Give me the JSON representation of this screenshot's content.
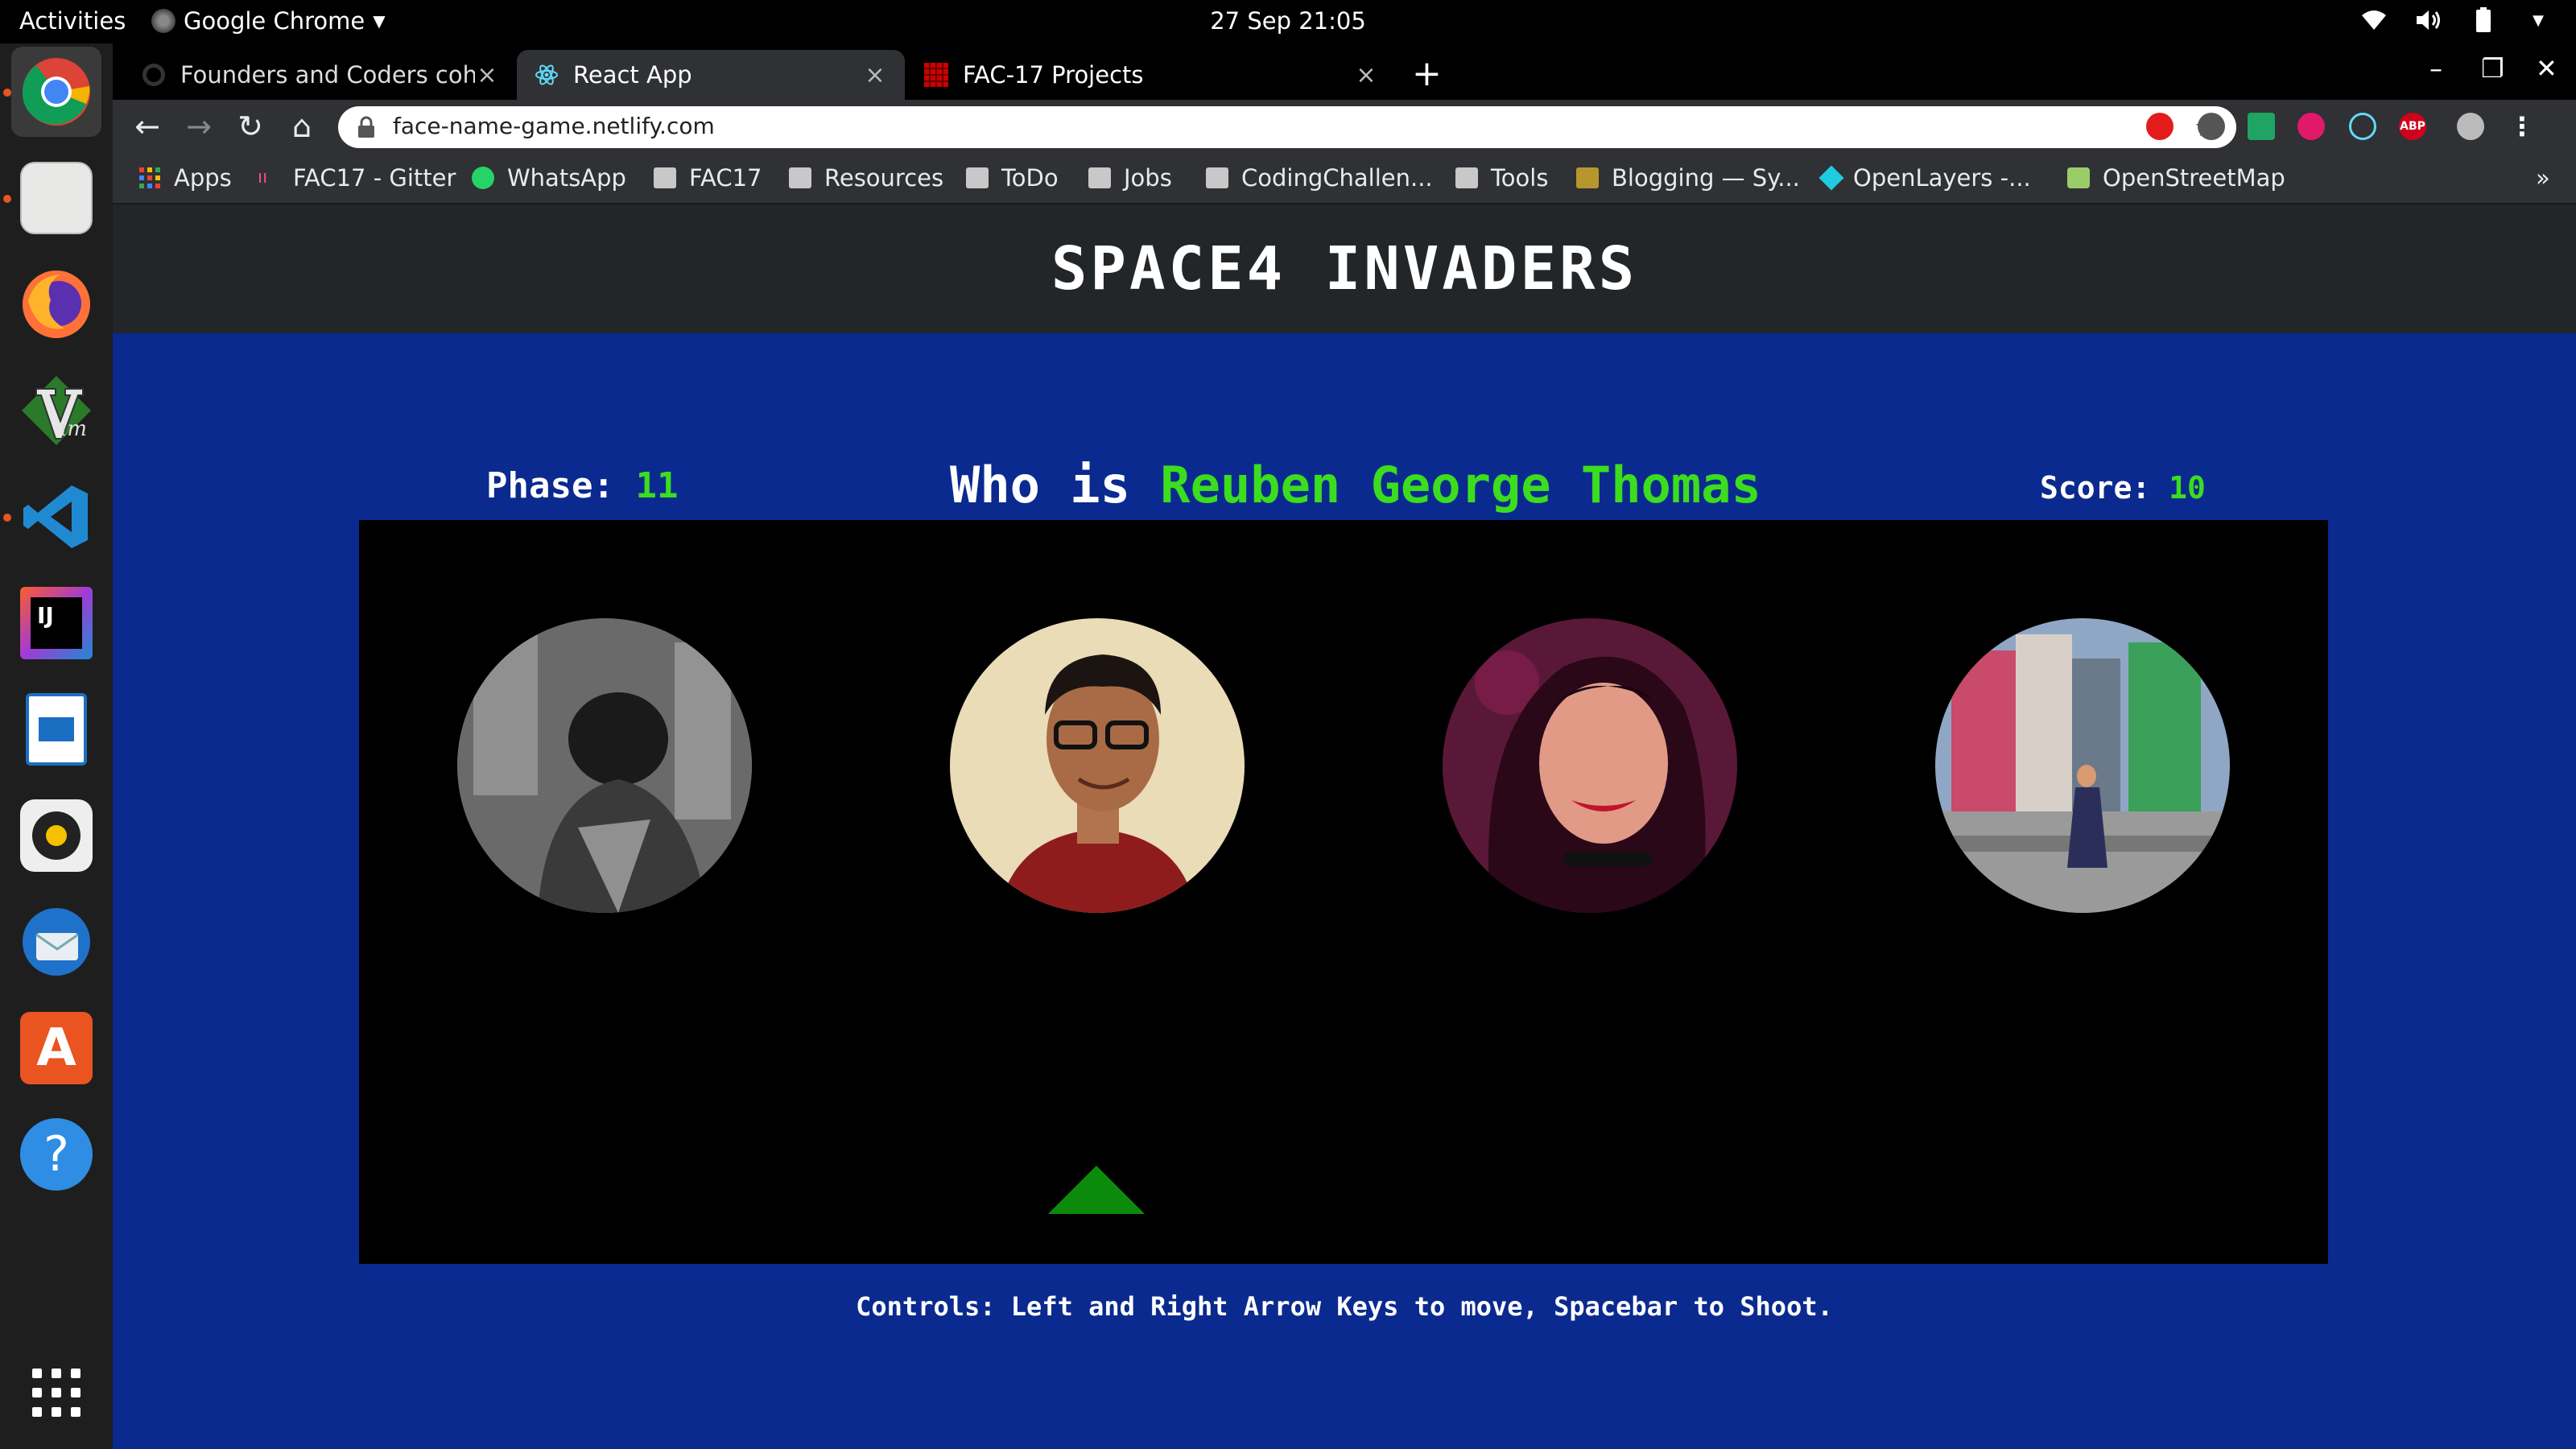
{
  "topbar": {
    "activities": "Activities",
    "app_name": "Google Chrome",
    "clock": "27 Sep  21:05",
    "tray_icons": [
      "wifi-icon",
      "volume-icon",
      "battery-icon",
      "power-menu-icon"
    ]
  },
  "dock": {
    "apps": [
      "Google Chrome",
      "Files",
      "Firefox",
      "Vim",
      "Visual Studio Code",
      "IntelliJ IDEA",
      "LibreOffice Writer",
      "Rhythmbox",
      "Thunderbird",
      "Ubuntu Software",
      "Help",
      "Show Applications"
    ]
  },
  "tabs": [
    {
      "label": "Founders and Coders coh",
      "close": "×"
    },
    {
      "label": "React App",
      "close": "×"
    },
    {
      "label": "FAC-17 Projects",
      "close": "×"
    }
  ],
  "new_tab": "+",
  "window": {
    "minimize": "–",
    "restore": "❐",
    "close": "✕"
  },
  "toolbar": {
    "back": "←",
    "forward": "→",
    "reload": "↻",
    "home": "⌂",
    "url": "face-name-game.netlify.com",
    "star": "☆"
  },
  "extensions": [
    "ABP"
  ],
  "bookmarks": [
    "Apps",
    "FAC17 - Gitter",
    "WhatsApp",
    "FAC17",
    "Resources",
    "ToDo",
    "Jobs",
    "CodingChallen...",
    "Tools",
    "Blogging — Sy...",
    "OpenLayers -...",
    "OpenStreetMap"
  ],
  "bookmarks_more": "»",
  "game": {
    "title": "SPACE4 INVADERS",
    "phase_label": "Phase:",
    "phase_value": "11",
    "question_prefix": "Who is",
    "question_name": "Reuben George Thomas",
    "score_label": "Score:",
    "score_value": "10",
    "controls": "Controls: Left and Right Arrow Keys to move, Spacebar to Shoot."
  },
  "colors": {
    "page_bg": "#0b2a8f",
    "header_bg": "#232629",
    "accent_green": "#3bdd1e",
    "ship": "#0c8a0c"
  }
}
